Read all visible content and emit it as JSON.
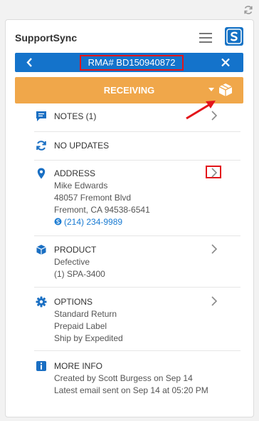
{
  "app": {
    "title": "SupportSync"
  },
  "rma": {
    "label": "RMA# BD150940872"
  },
  "status": {
    "label": "RECEIVING"
  },
  "notes": {
    "title": "NOTES (1)"
  },
  "updates": {
    "title": "NO UPDATES"
  },
  "address": {
    "title": "ADDRESS",
    "name": "Mike Edwards",
    "street": "48057 Fremont Blvd",
    "city": "Fremont, CA 94538-6541",
    "phone": "(214) 234-9989"
  },
  "product": {
    "title": "PRODUCT",
    "condition": "Defective",
    "item": "(1) SPA-3400"
  },
  "options": {
    "title": "OPTIONS",
    "lines": [
      "Standard Return",
      "Prepaid Label",
      "Ship by Expedited"
    ]
  },
  "more_info": {
    "title": "MORE INFO",
    "created": "Created by Scott Burgess on Sep 14",
    "email": "Latest email sent on Sep 14 at 05:20 PM"
  },
  "colors": {
    "accent": "#1473cb",
    "status": "#f0a74a",
    "highlight": "#e3151a",
    "link": "#1a7bd2"
  },
  "icons": [
    "refresh-icon",
    "menu-icon",
    "logo-icon",
    "back-icon",
    "close-icon",
    "caret-down-icon",
    "box-icon",
    "chat-icon",
    "sync-icon",
    "location-icon",
    "cube-icon",
    "gear-icon",
    "info-icon",
    "skype-icon",
    "chevron-right-icon"
  ]
}
